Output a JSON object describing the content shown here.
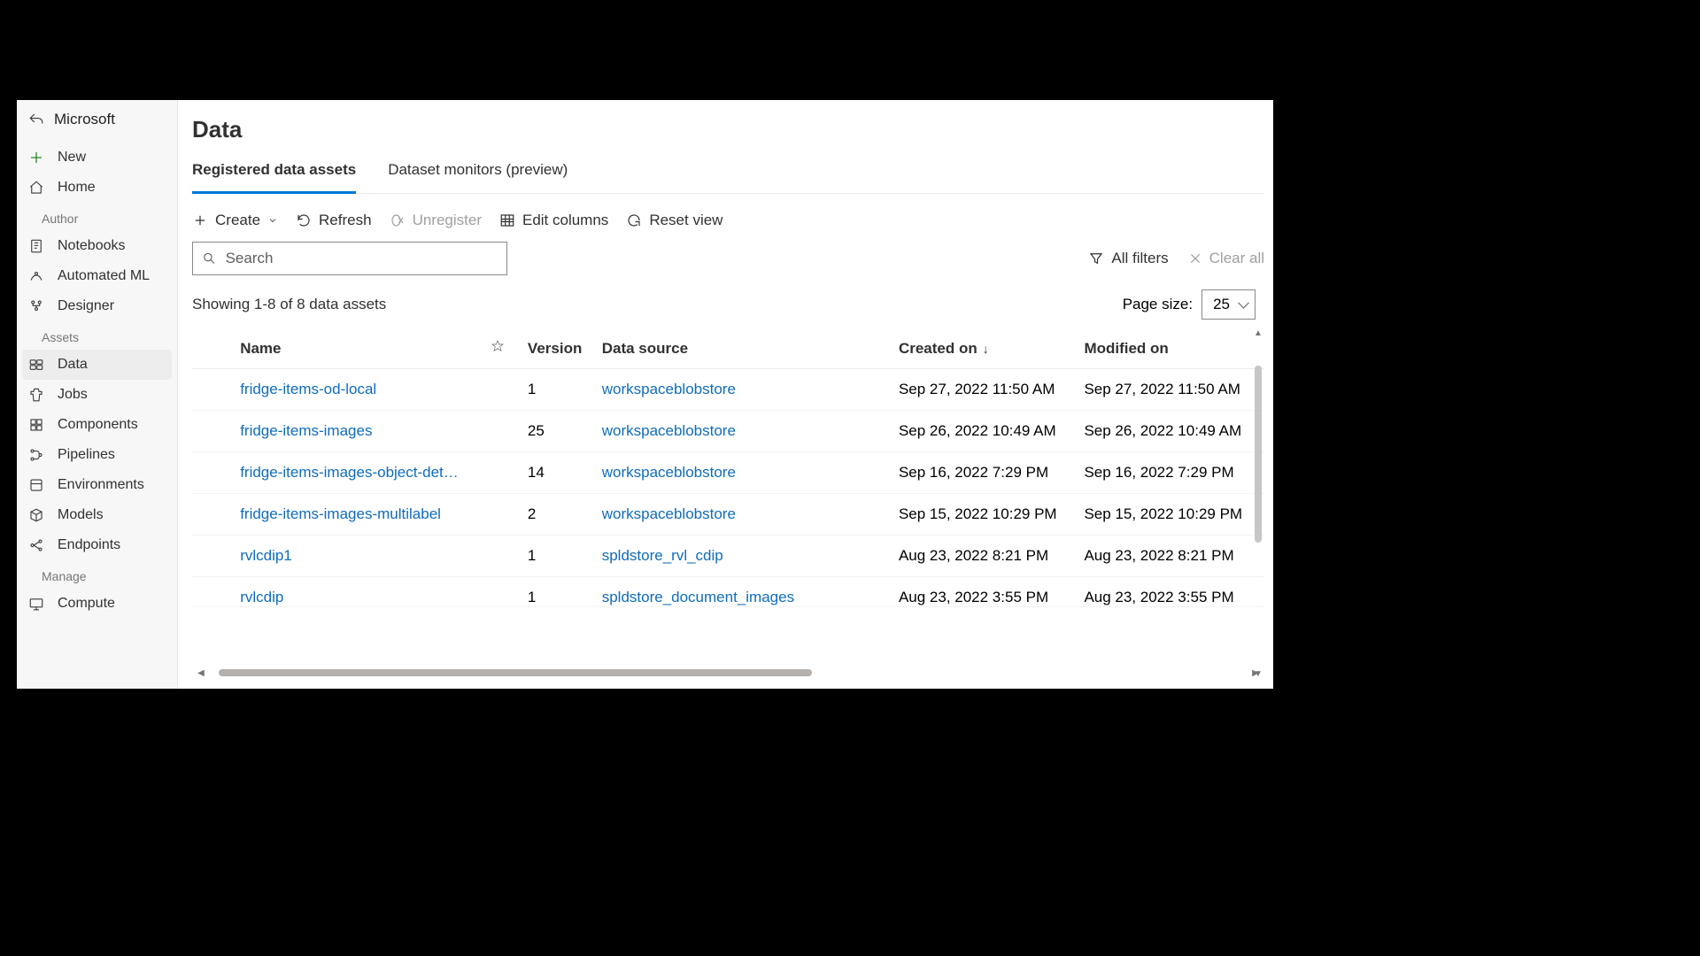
{
  "sidebar": {
    "workspace": "Microsoft",
    "new_label": "New",
    "items_top": [
      {
        "label": "Home"
      }
    ],
    "section_author": "Author",
    "items_author": [
      {
        "label": "Notebooks"
      },
      {
        "label": "Automated ML"
      },
      {
        "label": "Designer"
      }
    ],
    "section_assets": "Assets",
    "items_assets": [
      {
        "label": "Data"
      },
      {
        "label": "Jobs"
      },
      {
        "label": "Components"
      },
      {
        "label": "Pipelines"
      },
      {
        "label": "Environments"
      },
      {
        "label": "Models"
      },
      {
        "label": "Endpoints"
      }
    ],
    "section_manage": "Manage",
    "items_manage": [
      {
        "label": "Compute"
      }
    ]
  },
  "header": {
    "title": "Data"
  },
  "tabs": [
    {
      "label": "Registered data assets",
      "active": true
    },
    {
      "label": "Dataset monitors (preview)",
      "active": false
    }
  ],
  "toolbar": {
    "create": "Create",
    "refresh": "Refresh",
    "unregister": "Unregister",
    "edit_columns": "Edit columns",
    "reset_view": "Reset view"
  },
  "search": {
    "placeholder": "Search",
    "value": ""
  },
  "filters": {
    "all_filters": "All filters",
    "clear_all": "Clear all"
  },
  "meta": {
    "showing": "Showing 1-8 of 8 data assets",
    "page_size_label": "Page size:",
    "page_size_value": "25"
  },
  "columns": {
    "name": "Name",
    "version": "Version",
    "data_source": "Data source",
    "created_on": "Created on",
    "modified_on": "Modified on"
  },
  "rows": [
    {
      "name": "fridge-items-od-local",
      "version": "1",
      "source": "workspaceblobstore",
      "created": "Sep 27, 2022 11:50 AM",
      "modified": "Sep 27, 2022 11:50 AM"
    },
    {
      "name": "fridge-items-images",
      "version": "25",
      "source": "workspaceblobstore",
      "created": "Sep 26, 2022 10:49 AM",
      "modified": "Sep 26, 2022 10:49 AM"
    },
    {
      "name": "fridge-items-images-object-det…",
      "version": "14",
      "source": "workspaceblobstore",
      "created": "Sep 16, 2022 7:29 PM",
      "modified": "Sep 16, 2022 7:29 PM"
    },
    {
      "name": "fridge-items-images-multilabel",
      "version": "2",
      "source": "workspaceblobstore",
      "created": "Sep 15, 2022 10:29 PM",
      "modified": "Sep 15, 2022 10:29 PM"
    },
    {
      "name": "rvlcdip1",
      "version": "1",
      "source": "spldstore_rvl_cdip",
      "created": "Aug 23, 2022 8:21 PM",
      "modified": "Aug 23, 2022 8:21 PM"
    },
    {
      "name": "rvlcdip",
      "version": "1",
      "source": "spldstore_document_images",
      "created": "Aug 23, 2022 3:55 PM",
      "modified": "Aug 23, 2022 3:55 PM"
    }
  ]
}
